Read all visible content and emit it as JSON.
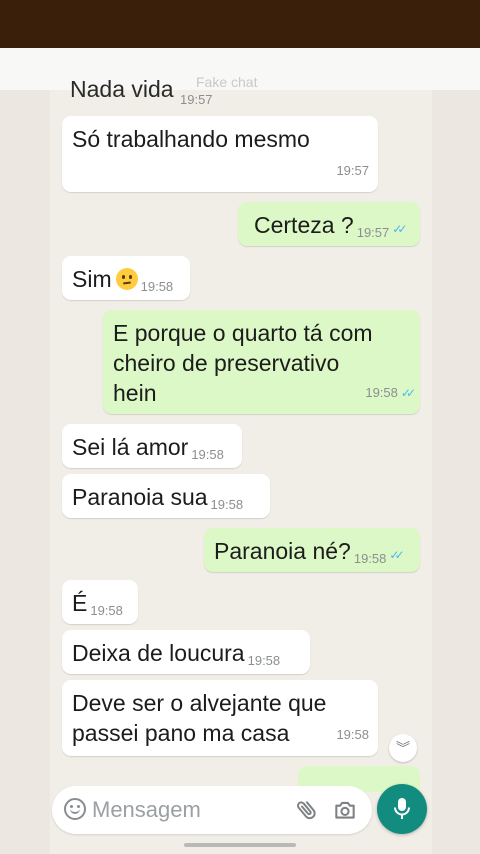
{
  "partial_top": {
    "text": "Nada vida",
    "faded": "Fake chat",
    "time": "19:57"
  },
  "messages": [
    {
      "id": "m1",
      "dir": "in",
      "text": "Só trabalhando mesmo",
      "time": "19:57"
    },
    {
      "id": "m2",
      "dir": "out",
      "text": "Certeza ?",
      "time": "19:57",
      "read": true
    },
    {
      "id": "m3",
      "dir": "in",
      "text": "Sim",
      "emoji": "slightly-frowning-face",
      "time": "19:58"
    },
    {
      "id": "m4",
      "dir": "out",
      "lines": [
        "E porque o quarto tá com",
        "cheiro de preservativo",
        "hein"
      ],
      "time": "19:58",
      "read": true
    },
    {
      "id": "m5",
      "dir": "in",
      "text": "Sei lá amor",
      "time": "19:58"
    },
    {
      "id": "m6",
      "dir": "in",
      "text": "Paranoia sua",
      "time": "19:58"
    },
    {
      "id": "m7",
      "dir": "out",
      "text": "Paranoia né?",
      "time": "19:58",
      "read": true
    },
    {
      "id": "m8",
      "dir": "in",
      "text": "É",
      "time": "19:58"
    },
    {
      "id": "m9",
      "dir": "in",
      "text": "Deixa de loucura",
      "time": "19:58"
    },
    {
      "id": "m10",
      "dir": "in",
      "lines": [
        "Deve ser o alvejante que",
        "passei pano ma casa"
      ],
      "time": "19:58"
    }
  ],
  "composer": {
    "placeholder": "Mensagem"
  },
  "colors": {
    "incoming": "#ffffff",
    "outgoing": "#dcf8c6",
    "accent": "#128c7e",
    "read_ticks": "#4fb6ec"
  },
  "icons": [
    "emoji-icon",
    "attach-icon",
    "camera-icon",
    "mic-icon",
    "scroll-down-icon",
    "double-check-icon"
  ]
}
